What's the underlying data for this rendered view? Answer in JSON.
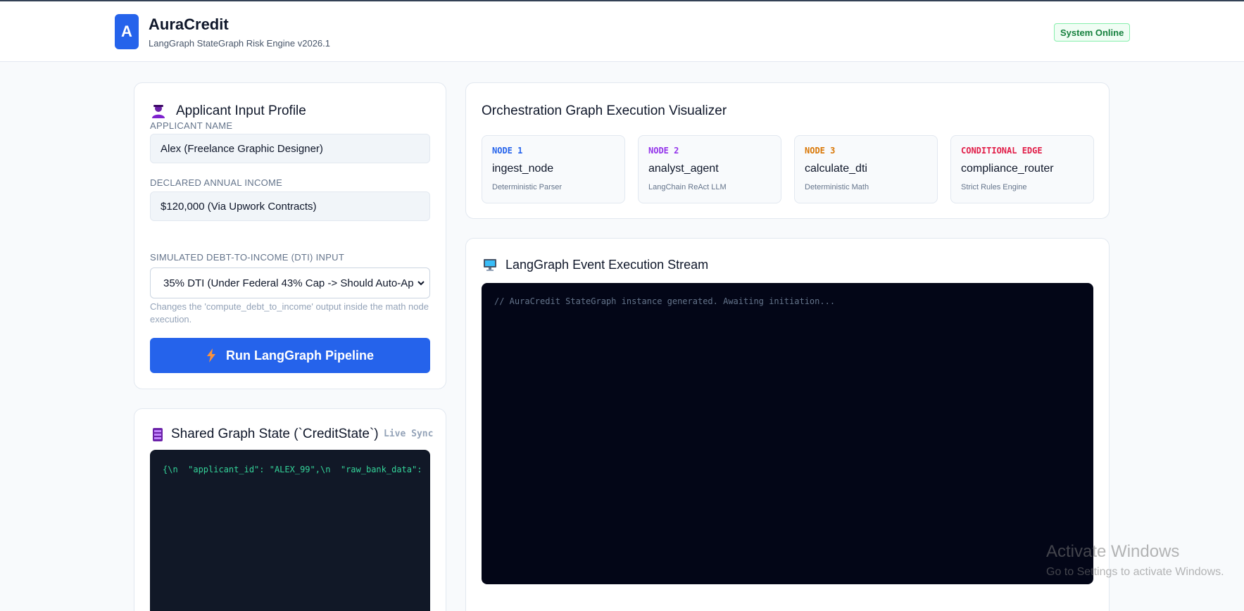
{
  "header": {
    "logo_letter": "A",
    "title": "AuraCredit",
    "subtitle": "LangGraph StateGraph Risk Engine v2026.1",
    "status": "System Online"
  },
  "applicant": {
    "title": "Applicant Input Profile",
    "icon": "person-icon",
    "name_label": "APPLICANT NAME",
    "name_value": "Alex (Freelance Graphic Designer)",
    "income_label": "DECLARED ANNUAL INCOME",
    "income_value": "$120,000 (Via Upwork Contracts)",
    "dti_label": "SIMULATED DEBT-TO-INCOME (DTI) INPUT",
    "dti_selected": "35% DTI (Under Federal 43% Cap -> Should Auto-Ap",
    "dti_help": "Changes the 'compute_debt_to_income' output inside the math node execution.",
    "run_label": "Run LangGraph Pipeline"
  },
  "state": {
    "title": "Shared Graph State (`CreditState`)",
    "icon": "database-icon",
    "live_sync": "Live Sync",
    "code": "{\\n  \"applicant_id\": \"ALEX_99\",\\n  \"raw_bank_data\":"
  },
  "graph": {
    "title": "Orchestration Graph Execution Visualizer",
    "nodes": [
      {
        "tag": "NODE 1",
        "name": "ingest_node",
        "desc": "Deterministic Parser",
        "color": "#2563eb"
      },
      {
        "tag": "NODE 2",
        "name": "analyst_agent",
        "desc": "LangChain ReAct LLM",
        "color": "#9333ea"
      },
      {
        "tag": "NODE 3",
        "name": "calculate_dti",
        "desc": "Deterministic Math",
        "color": "#d97706"
      },
      {
        "tag": "CONDITIONAL EDGE",
        "name": "compliance_router",
        "desc": "Strict Rules Engine",
        "color": "#e11d48"
      }
    ]
  },
  "stream": {
    "title": "LangGraph Event Execution Stream",
    "icon": "monitor-icon",
    "log": "// AuraCredit StateGraph instance generated. Awaiting initiation..."
  },
  "watermark": {
    "title": "Activate Windows",
    "subtitle": "Go to Settings to activate Windows."
  },
  "colors": {
    "accent": "#2563eb",
    "online": "#15803d",
    "terminal_bg": "#030617",
    "state_bg": "#111827",
    "state_text": "#34d399"
  }
}
